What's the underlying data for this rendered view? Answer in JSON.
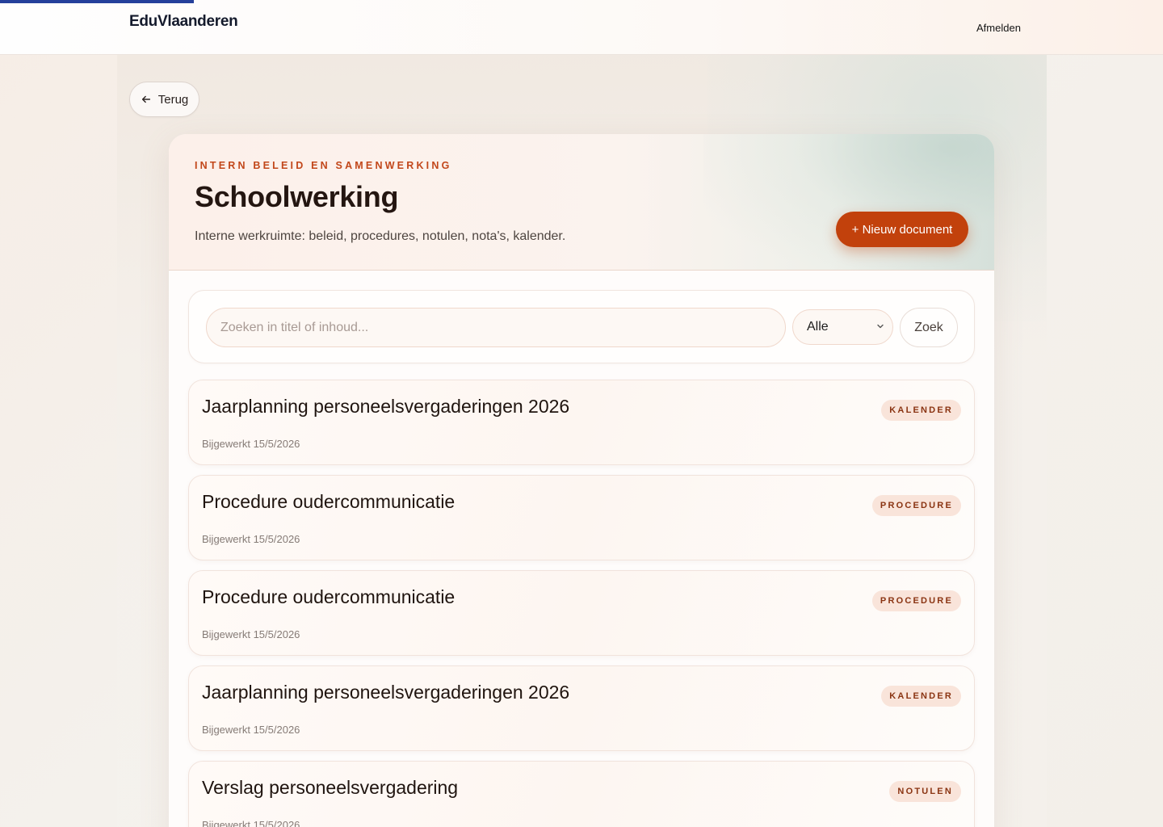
{
  "header": {
    "brand": "EduVlaanderen",
    "logout_label": "Afmelden"
  },
  "back_label": "Terug",
  "hero": {
    "kicker": "INTERN BELEID EN SAMENWERKING",
    "title": "Schoolwerking",
    "subtitle": "Interne werkruimte: beleid, procedures, notulen, nota's, kalender.",
    "new_document_label": "+ Nieuw document"
  },
  "search": {
    "placeholder": "Zoeken in titel of inhoud...",
    "filter_selected": "Alle",
    "button_label": "Zoek"
  },
  "documents": [
    {
      "title": "Jaarplanning personeelsvergaderingen 2026",
      "meta": "Bijgewerkt 15/5/2026",
      "badge": "KALENDER"
    },
    {
      "title": "Procedure oudercommunicatie",
      "meta": "Bijgewerkt 15/5/2026",
      "badge": "PROCEDURE"
    },
    {
      "title": "Procedure oudercommunicatie",
      "meta": "Bijgewerkt 15/5/2026",
      "badge": "PROCEDURE"
    },
    {
      "title": "Jaarplanning personeelsvergaderingen 2026",
      "meta": "Bijgewerkt 15/5/2026",
      "badge": "KALENDER"
    },
    {
      "title": "Verslag personeelsvergadering",
      "meta": "Bijgewerkt 15/5/2026",
      "badge": "NOTULEN"
    }
  ],
  "colors": {
    "accent": "#c2410c",
    "kicker": "#c2471a",
    "brand_line": "#25409b",
    "badge_bg": "#f9e4da",
    "badge_text": "#8a3412"
  },
  "icons": {
    "back": "arrow-left-icon",
    "select": "chevron-down-icon"
  }
}
